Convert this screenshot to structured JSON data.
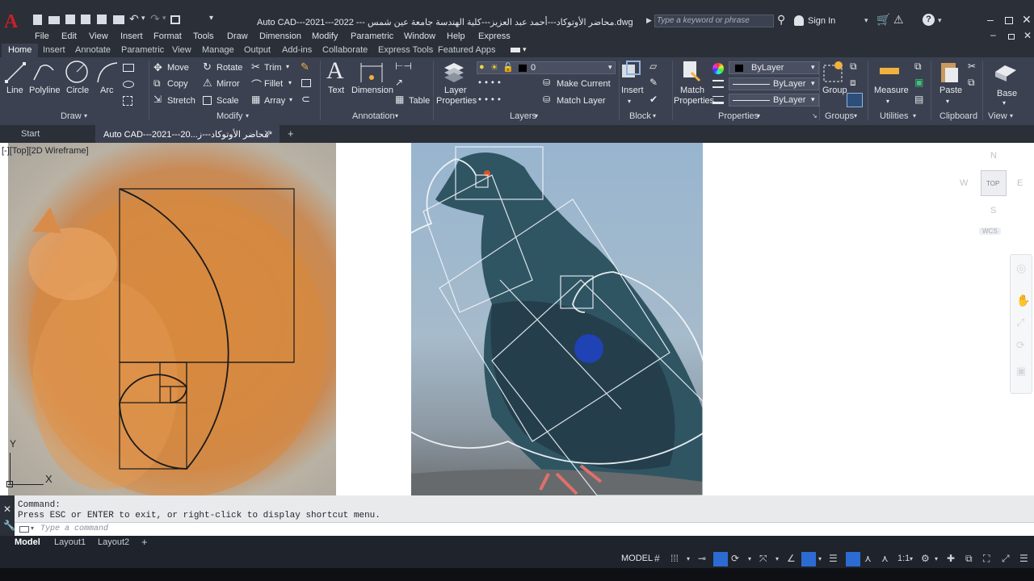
{
  "title_bar": {
    "title": "Auto CAD---2021---2022 --- محاضر الأوتوكاد---أحمد عبد العزيز---كلية الهندسة جامعة عين شمس.dwg",
    "search_placeholder": "Type a keyword or phrase",
    "sign_in": "Sign In",
    "app_logo": "A"
  },
  "menu": [
    "File",
    "Edit",
    "View",
    "Insert",
    "Format",
    "Tools",
    "Draw",
    "Dimension",
    "Modify",
    "Parametric",
    "Window",
    "Help",
    "Express"
  ],
  "ribbon_tabs": [
    "Home",
    "Insert",
    "Annotate",
    "Parametric",
    "View",
    "Manage",
    "Output",
    "Add-ins",
    "Collaborate",
    "Express Tools",
    "Featured Apps"
  ],
  "active_ribbon_tab": "Home",
  "ribbon": {
    "draw": {
      "line": "Line",
      "polyline": "Polyline",
      "circle": "Circle",
      "arc": "Arc",
      "label": "Draw"
    },
    "modify": {
      "move": "Move",
      "rotate": "Rotate",
      "trim": "Trim",
      "copy": "Copy",
      "mirror": "Mirror",
      "fillet": "Fillet",
      "stretch": "Stretch",
      "scale": "Scale",
      "array": "Array",
      "label": "Modify"
    },
    "annotation": {
      "text": "Text",
      "dimension": "Dimension",
      "table": "Table",
      "label": "Annotation"
    },
    "layers": {
      "layer_properties_1": "Layer",
      "layer_properties_2": "Properties",
      "current_layer": "0",
      "make_current": "Make Current",
      "match_layer": "Match Layer",
      "label": "Layers"
    },
    "block": {
      "insert": "Insert",
      "label": "Block"
    },
    "properties": {
      "match_1": "Match",
      "match_2": "Properties",
      "color": "ByLayer",
      "linetype": "ByLayer",
      "lineweight": "ByLayer",
      "label": "Properties"
    },
    "groups": {
      "group": "Group",
      "label": "Groups"
    },
    "utilities": {
      "measure": "Measure",
      "label": "Utilities"
    },
    "clipboard": {
      "paste": "Paste",
      "label": "Clipboard"
    },
    "view": {
      "base": "Base",
      "label": "View"
    }
  },
  "doc_tabs": {
    "start": "Start",
    "active": "Auto CAD---2021---20...محاضر الأوتوكاد---ز*",
    "close": "×",
    "add": "+"
  },
  "viewport": {
    "label": "[-][Top][2D Wireframe]",
    "ucs_y": "Y",
    "ucs_x": "X",
    "viewcube": {
      "n": "N",
      "s": "S",
      "e": "E",
      "w": "W",
      "top": "TOP",
      "wcs": "WCS"
    }
  },
  "command": {
    "line1": "Command:",
    "line2": "Press ESC or ENTER to exit, or right-click to display shortcut menu.",
    "placeholder": "Type a command"
  },
  "layout_tabs": [
    "Model",
    "Layout1",
    "Layout2"
  ],
  "layout_add": "+",
  "status": {
    "model": "MODEL",
    "scale": "1:1"
  },
  "colors": {
    "ribbon_bg": "#3b4150",
    "title_bg": "#2b2f37",
    "accent_red": "#c8202b",
    "canvas": "#ffffff"
  }
}
